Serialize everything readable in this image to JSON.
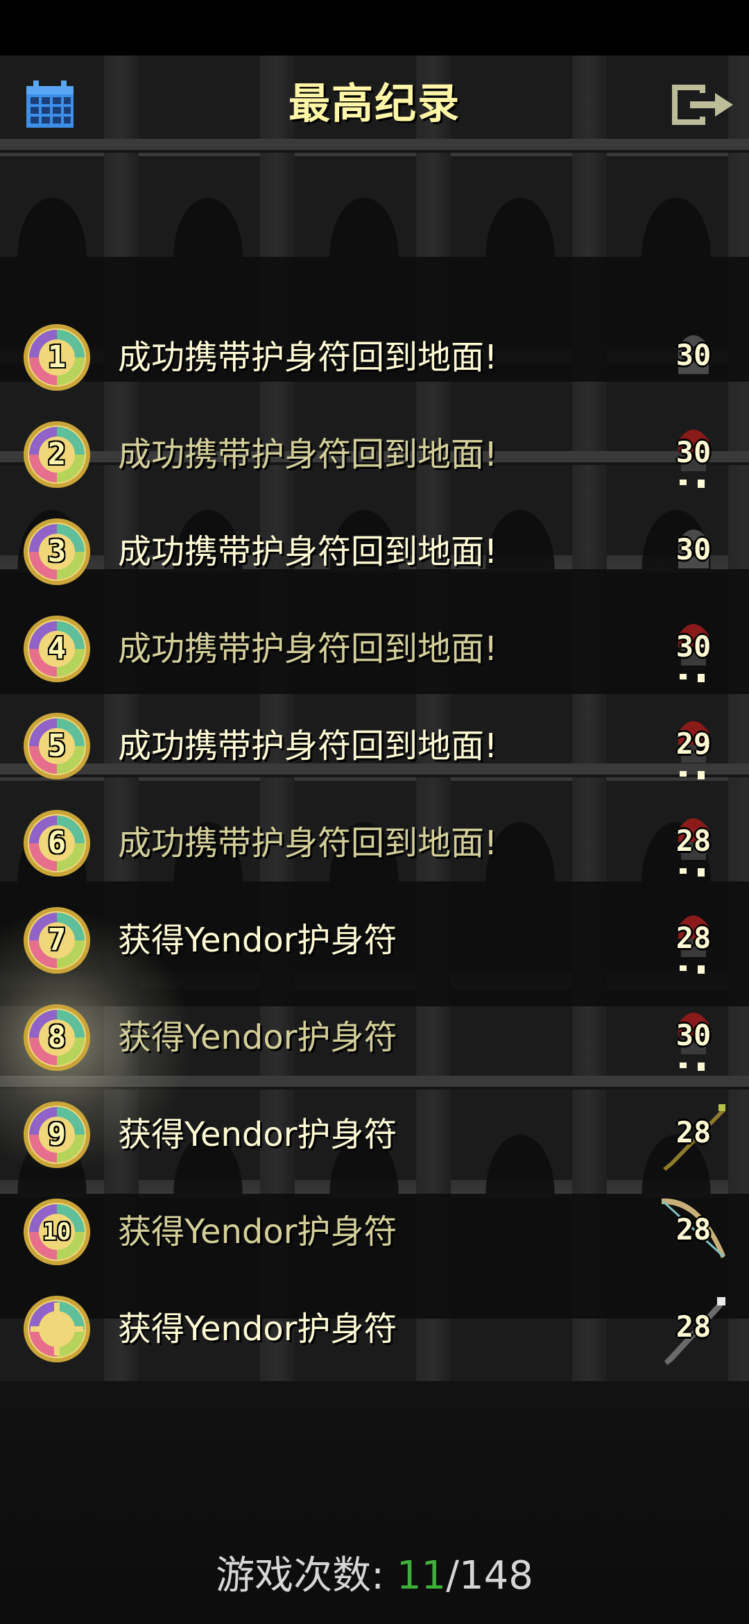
{
  "header": {
    "title": "最高纪录"
  },
  "rankings": [
    {
      "rank": "1",
      "text": "成功携带护身符回到地面!",
      "level": "30",
      "hero": "rogue"
    },
    {
      "rank": "2",
      "text": "成功携带护身符回到地面!",
      "level": "30",
      "hero": "warrior"
    },
    {
      "rank": "3",
      "text": "成功携带护身符回到地面!",
      "level": "30",
      "hero": "rogue"
    },
    {
      "rank": "4",
      "text": "成功携带护身符回到地面!",
      "level": "30",
      "hero": "warrior"
    },
    {
      "rank": "5",
      "text": "成功携带护身符回到地面!",
      "level": "29",
      "hero": "warrior"
    },
    {
      "rank": "6",
      "text": "成功携带护身符回到地面!",
      "level": "28",
      "hero": "warrior"
    },
    {
      "rank": "7",
      "text": "获得Yendor护身符",
      "level": "28",
      "hero": "warrior"
    },
    {
      "rank": "8",
      "text": "获得Yendor护身符",
      "level": "30",
      "hero": "warrior"
    },
    {
      "rank": "9",
      "text": "获得Yendor护身符",
      "level": "28",
      "hero": "mage"
    },
    {
      "rank": "10",
      "text": "获得Yendor护身符",
      "level": "28",
      "hero": "huntress"
    },
    {
      "rank": "",
      "text": "获得Yendor护身符",
      "level": "28",
      "hero": "duelist"
    }
  ],
  "footer": {
    "label": "游戏次数:",
    "current": "11",
    "total": "/148"
  },
  "colors": {
    "title": "#fff7a8",
    "text_bright": "#fffbd6",
    "text_dim": "#d4cf9a",
    "games_current": "#3fae3a",
    "calendar_icon": "#3d8fe8"
  }
}
